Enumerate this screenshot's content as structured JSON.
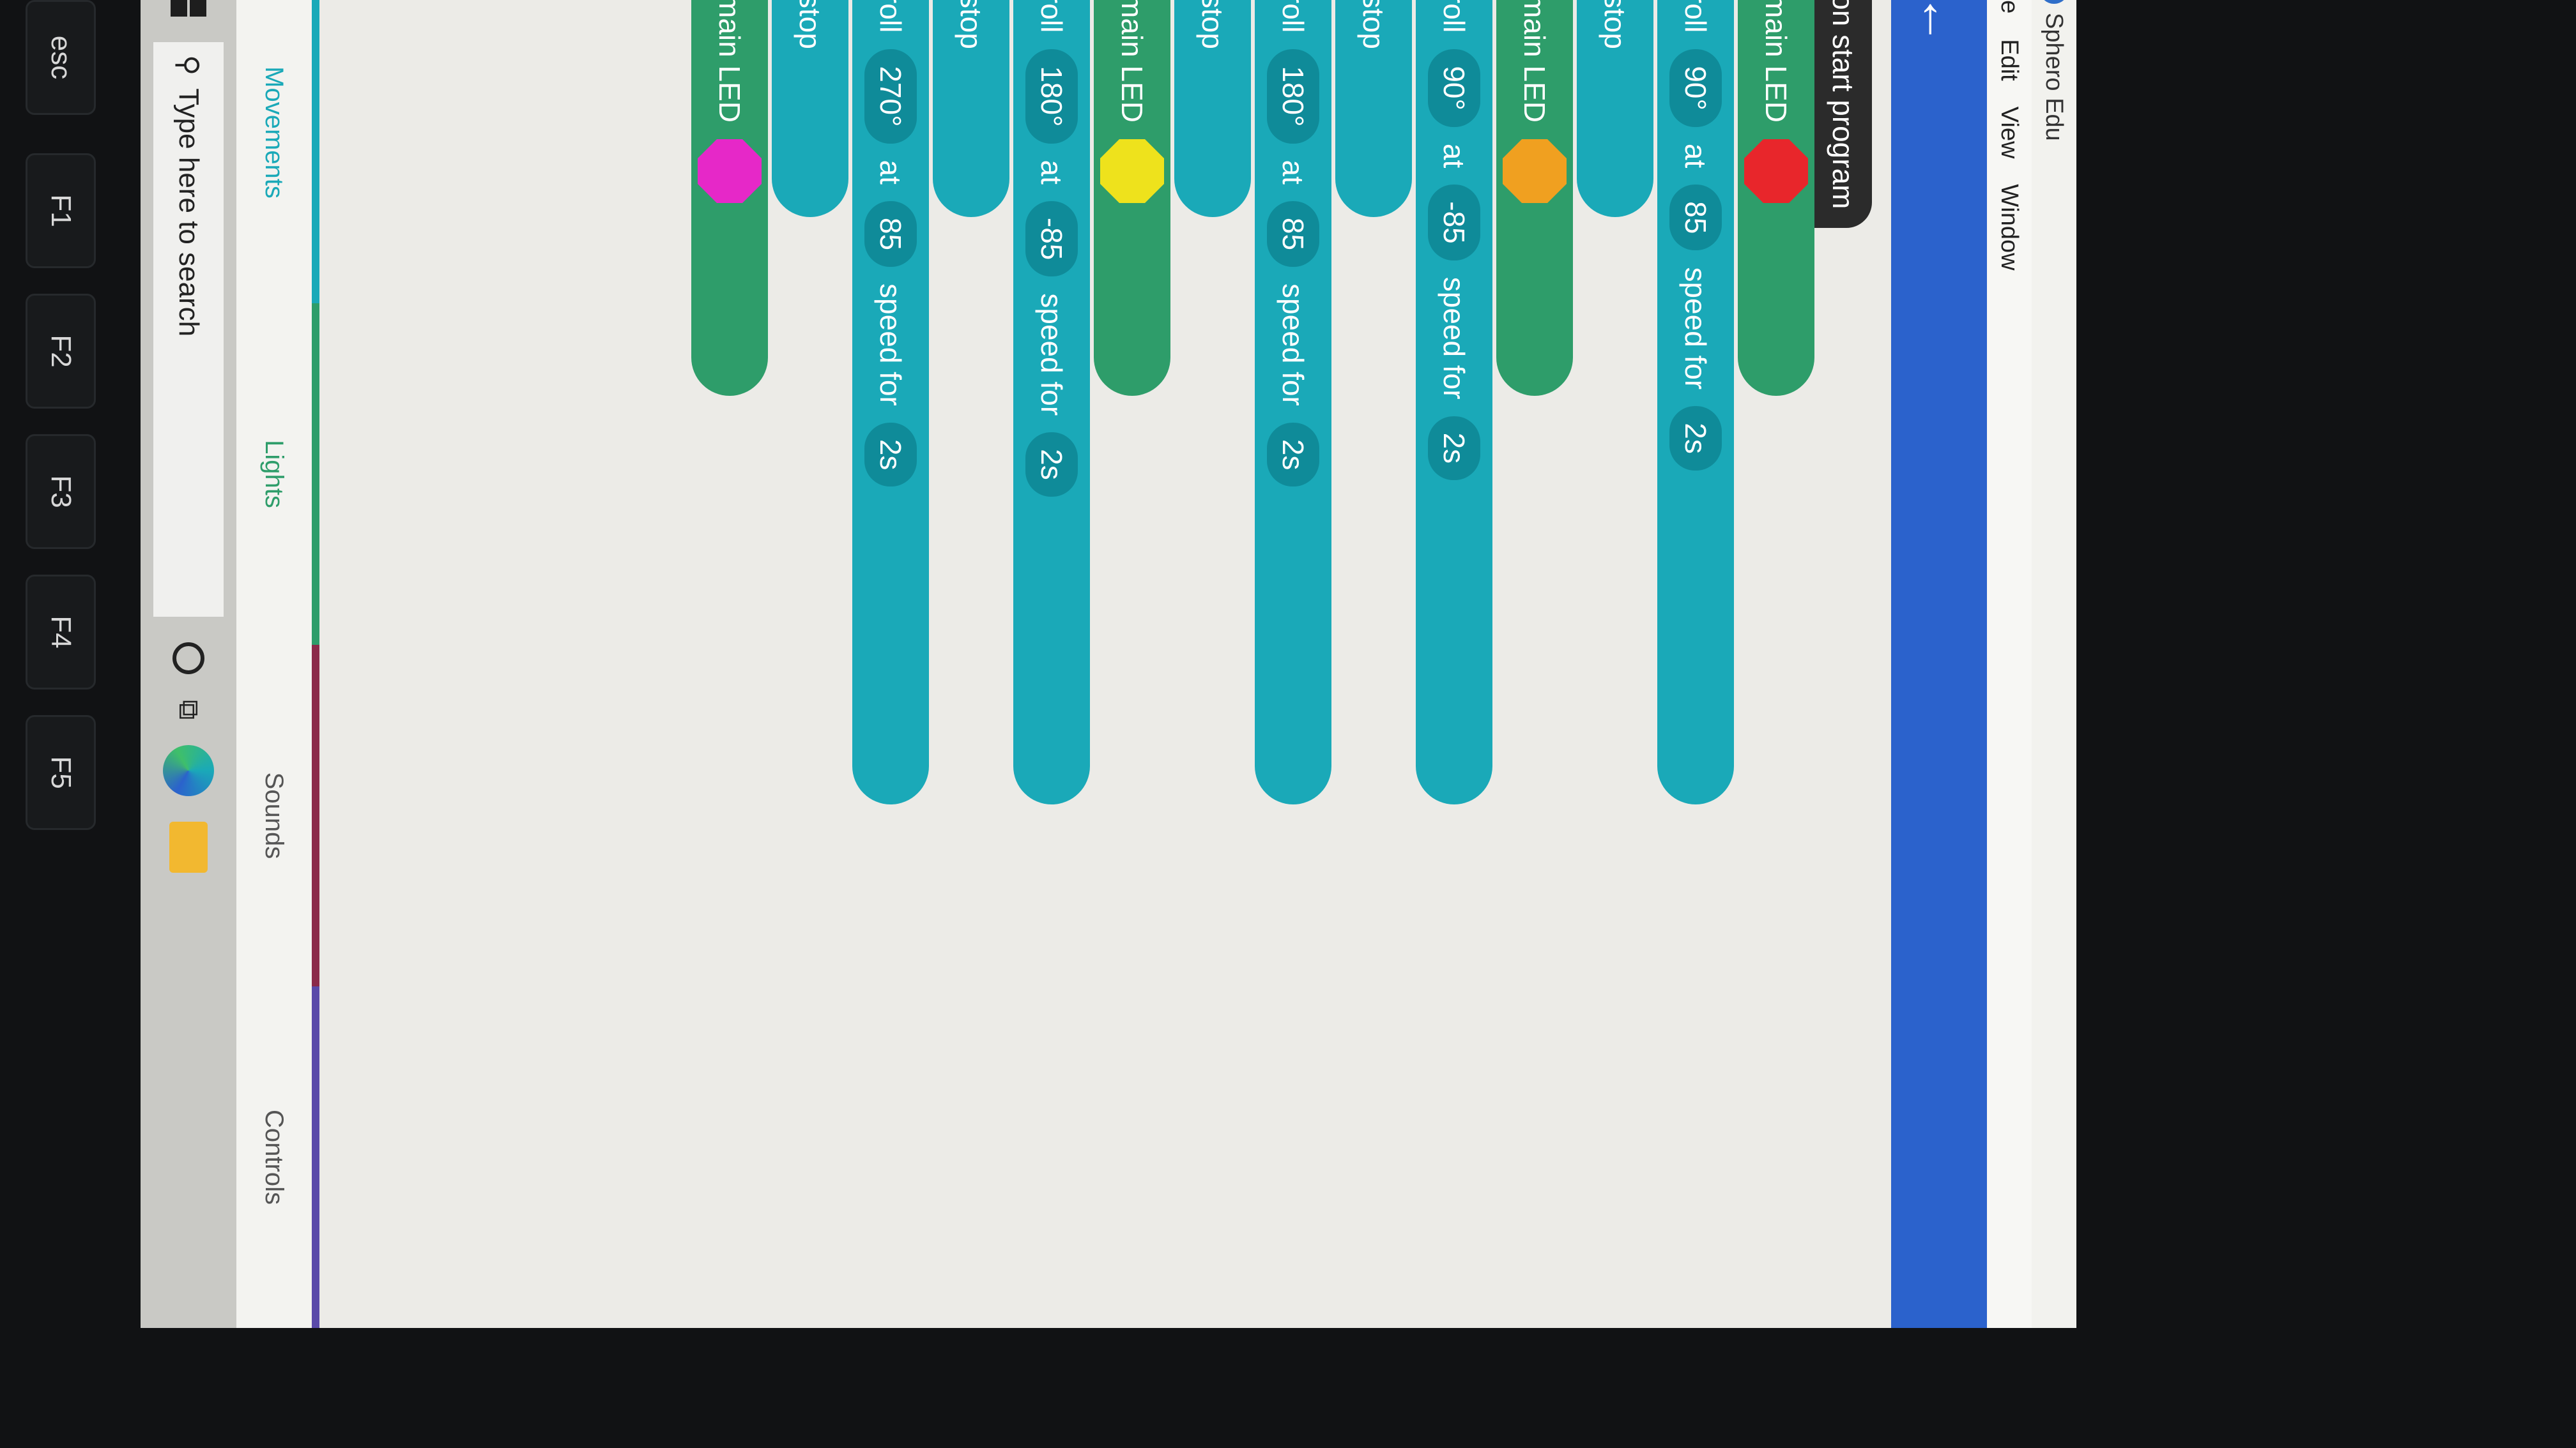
{
  "window": {
    "title": "Sphero Edu",
    "app_icon_letter": "edu"
  },
  "menu": [
    "File",
    "Edit",
    "View",
    "Window"
  ],
  "program": {
    "start_label": "on start program",
    "blocks": [
      {
        "type": "led",
        "label": "main LED",
        "color": "#e8262b"
      },
      {
        "type": "roll",
        "label": "roll",
        "heading": "90°",
        "at": "at",
        "speed": "85",
        "for": "speed for",
        "duration": "2s"
      },
      {
        "type": "stop",
        "label": "stop"
      },
      {
        "type": "led",
        "label": "main LED",
        "color": "#f0a020"
      },
      {
        "type": "roll",
        "label": "roll",
        "heading": "90°",
        "at": "at",
        "speed": "-85",
        "for": "speed for",
        "duration": "2s"
      },
      {
        "type": "stop",
        "label": "stop"
      },
      {
        "type": "roll",
        "label": "roll",
        "heading": "180°",
        "at": "at",
        "speed": "85",
        "for": "speed for",
        "duration": "2s"
      },
      {
        "type": "stop",
        "label": "stop"
      },
      {
        "type": "led",
        "label": "main LED",
        "color": "#eee21c"
      },
      {
        "type": "roll",
        "label": "roll",
        "heading": "180°",
        "at": "at",
        "speed": "-85",
        "for": "speed for",
        "duration": "2s"
      },
      {
        "type": "stop",
        "label": "stop"
      },
      {
        "type": "roll",
        "label": "roll",
        "heading": "270°",
        "at": "at",
        "speed": "85",
        "for": "speed for",
        "duration": "2s"
      },
      {
        "type": "stop",
        "label": "stop"
      },
      {
        "type": "led",
        "label": "main LED",
        "color": "#e628c8"
      }
    ]
  },
  "tabs": [
    "Movements",
    "Lights",
    "Sounds",
    "Controls"
  ],
  "taskbar": {
    "search_placeholder": "Type here to search"
  },
  "keyboard": {
    "keys": [
      "esc",
      "F1",
      "F2",
      "F3",
      "F4",
      "F5",
      "~",
      "!",
      "@",
      "#"
    ]
  },
  "colors": {
    "accent": "#2b62cc",
    "movement": "#1aa9b8",
    "lights": "#2e9d6a"
  }
}
